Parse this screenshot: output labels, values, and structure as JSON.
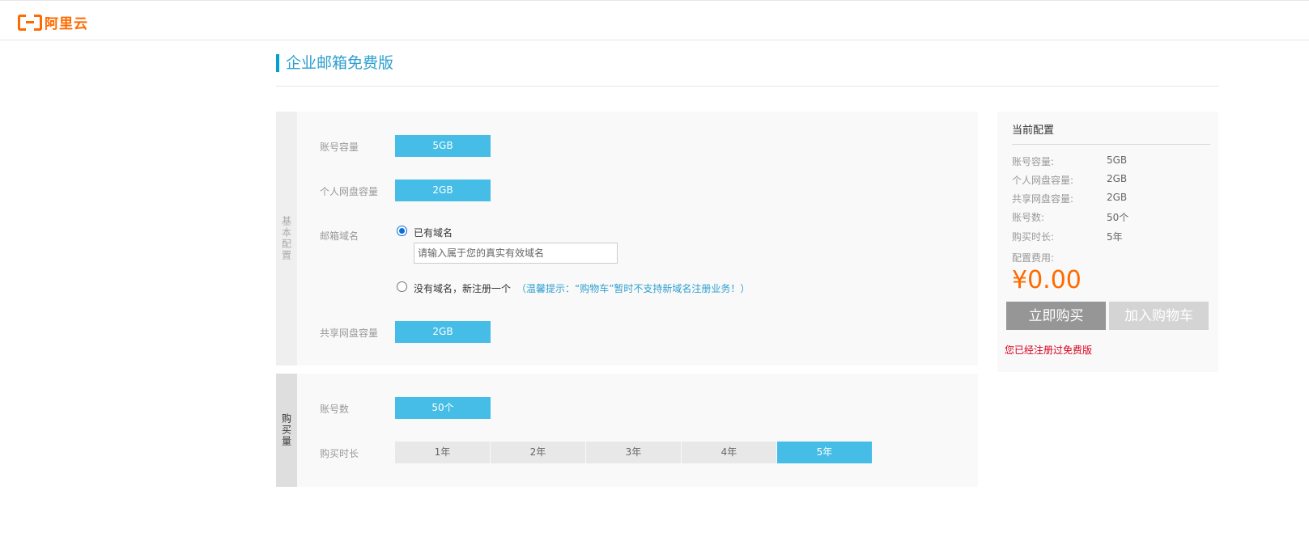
{
  "header": {
    "logo_text": "阿里云"
  },
  "page": {
    "title": "企业邮箱免费版"
  },
  "basic_config": {
    "side_label": "基本配置",
    "account_capacity": {
      "label": "账号容量",
      "value": "5GB"
    },
    "personal_disk": {
      "label": "个人网盘容量",
      "value": "2GB"
    },
    "mail_domain": {
      "label": "邮箱域名",
      "option_existing": "已有域名",
      "input_placeholder": "请输入属于您的真实有效域名",
      "option_new": "没有域名，新注册一个",
      "tip": "（温馨提示：“购物车”暂时不支持新域名注册业务！）"
    },
    "shared_disk": {
      "label": "共享网盘容量",
      "value": "2GB"
    }
  },
  "purchase_qty": {
    "side_label": "购买量",
    "accounts": {
      "label": "账号数",
      "value": "50个"
    },
    "duration": {
      "label": "购买时长",
      "options": [
        "1年",
        "2年",
        "3年",
        "4年",
        "5年"
      ],
      "selected": "5年"
    }
  },
  "summary": {
    "title": "当前配置",
    "rows": [
      {
        "key": "账号容量:",
        "value": "5GB"
      },
      {
        "key": "个人网盘容量:",
        "value": "2GB"
      },
      {
        "key": "共享网盘容量:",
        "value": "2GB"
      },
      {
        "key": "账号数:",
        "value": "50个"
      },
      {
        "key": "购买时长:",
        "value": "5年"
      }
    ],
    "fee_label": "配置费用:",
    "price": "¥0.00",
    "buy_label": "立即购买",
    "cart_label": "加入购物车",
    "notice": "您已经注册过免费版"
  },
  "colors": {
    "brand": "#ff6a00",
    "accent": "#45bde6",
    "title": "#2e9fd0",
    "warning": "#d9001b"
  }
}
